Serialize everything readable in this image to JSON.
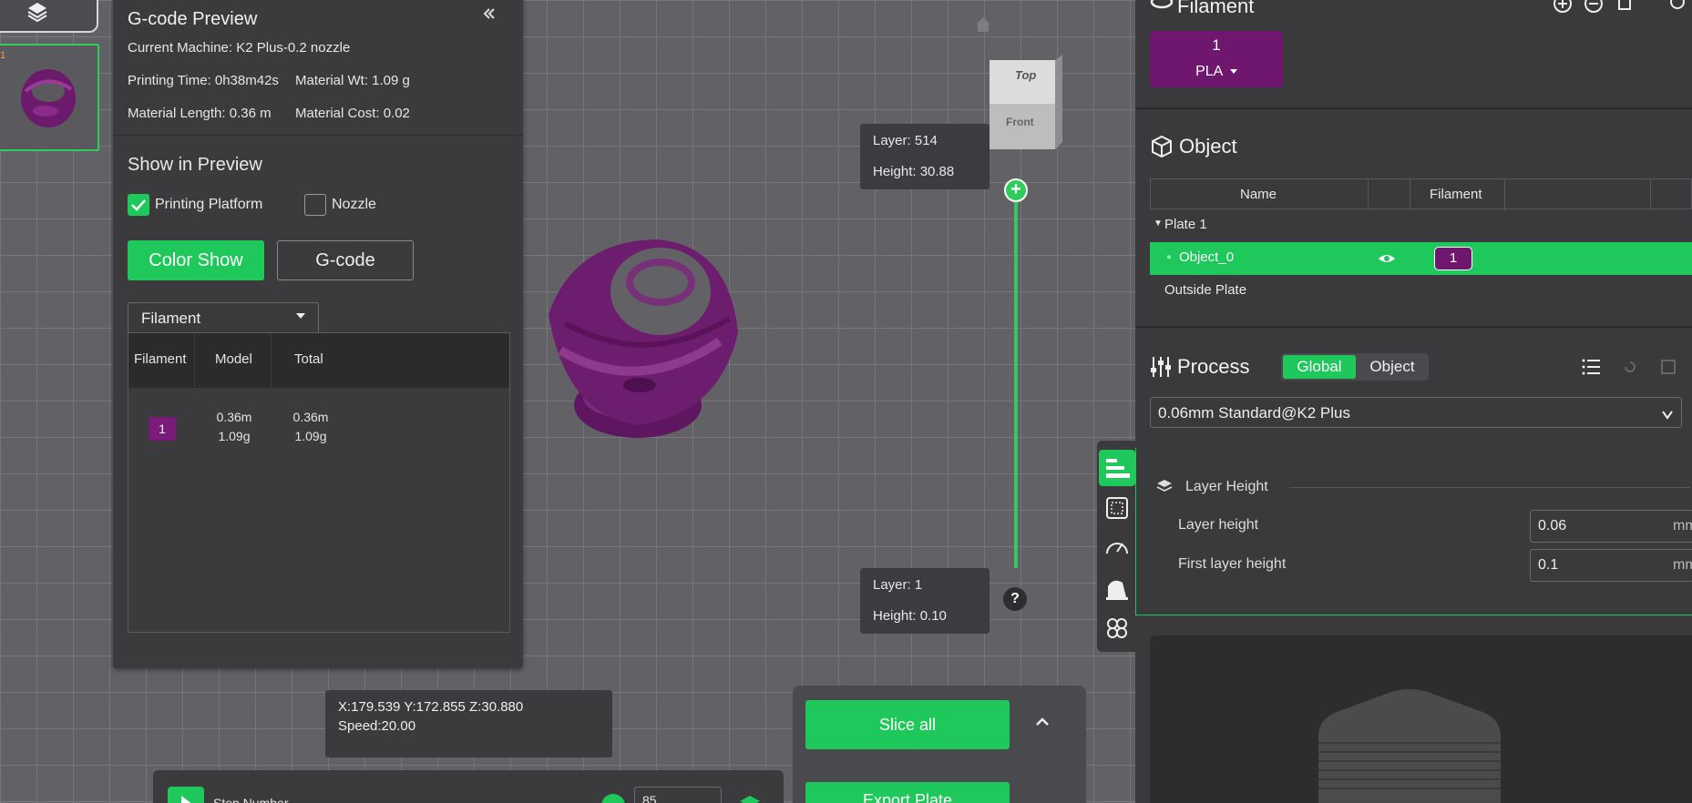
{
  "gcode_panel": {
    "title": "G-code Preview",
    "collapse_icon": "double-chevron-left",
    "current_machine": "Current Machine: K2 Plus-0.2 nozzle",
    "printing_time": "Printing Time: 0h38m42s",
    "material_wt": "Material Wt: 1.09 g",
    "material_length": "Material Length: 0.36 m",
    "material_cost": "Material Cost: 0.02",
    "show_in_preview": "Show in Preview",
    "printing_platform": "Printing Platform",
    "nozzle": "Nozzle",
    "color_show": "Color Show",
    "gcode": "G-code",
    "dropdown_value": "Filament",
    "table_headers": [
      "Filament",
      "Model",
      "Total"
    ],
    "row": {
      "filament": "1",
      "model_len": "0.36m",
      "model_wt": "1.09g",
      "total_len": "0.36m",
      "total_wt": "1.09g"
    }
  },
  "thumbnail": {
    "plate_number": "1"
  },
  "view_cube": {
    "top": "Top",
    "front": "Front"
  },
  "layer_slider": {
    "top_layer": "Layer: 514",
    "top_height": "Height: 30.88",
    "bottom_layer": "Layer: 1",
    "bottom_height": "Height: 0.10",
    "help": "?"
  },
  "coords": {
    "position": "X:179.539  Y:172.855  Z:30.880",
    "speed": "Speed:20.00"
  },
  "bottom_bar": {
    "step_label": "Step Number",
    "step_value": "85"
  },
  "slice": {
    "slice_all": "Slice all",
    "export": "Export Plate"
  },
  "right_panel": {
    "filament_title": "Filament",
    "filament_chip": {
      "number": "1",
      "type": "PLA"
    },
    "object_title": "Object",
    "object_headers": {
      "name": "Name",
      "filament": "Filament"
    },
    "plate": "Plate 1",
    "object_name": "Object_0",
    "object_filament": "1",
    "outside_plate": "Outside Plate",
    "process_title": "Process",
    "tab_global": "Global",
    "tab_object": "Object",
    "preset": "0.06mm Standard@K2 Plus",
    "layer_height_section": "Layer Height",
    "layer_height_label": "Layer height",
    "layer_height_value": "0.06",
    "layer_height_unit": "mm",
    "first_layer_label": "First layer height",
    "first_layer_value": "0.1",
    "first_layer_unit": "mm"
  },
  "colors": {
    "accent": "#1fc85a",
    "filament_purple": "#7a1a7a",
    "panel": "#3b3b3e"
  }
}
